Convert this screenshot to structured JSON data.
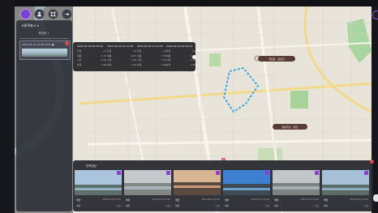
{
  "toolbar": {
    "buttons": [
      {
        "icon": "compass-icon",
        "active": true
      },
      {
        "icon": "person-icon",
        "active": false
      },
      {
        "icon": "grid-icon",
        "active": false
      },
      {
        "icon": "exit-icon",
        "active": false
      }
    ]
  },
  "panel": {
    "select_value": "서울특별시 ▾",
    "subtitle": "행당동 1",
    "item_title": "2024-02-15 14:48 CCTV ●"
  },
  "popup": {
    "columns": [
      {
        "title": "2024-02-16 09:55:43",
        "rows": [
          [
            "유형",
            "(1)"
          ],
          [
            "내용",
            "1.73"
          ],
          [
            "시설",
            "1.56"
          ],
          [
            "상태",
            "1.49"
          ]
        ]
      },
      {
        "title": "2024-02-16 12:11:59",
        "rows": [
          [
            "유형",
            "(1)"
          ],
          [
            "내용",
            "0.47"
          ],
          [
            "시설",
            "1.28"
          ],
          [
            "상태",
            "1.29"
          ]
        ]
      },
      {
        "title": "2024-02-16 17:01:35",
        "rows": [
          [
            "유형",
            "(1)"
          ],
          [
            "내용",
            "1.70"
          ],
          [
            "시설",
            "1.37"
          ],
          [
            "상태",
            "1.26"
          ]
        ]
      },
      {
        "title": "2024-02-16 20:09:10",
        "rows": [
          [
            "유형",
            "(1)"
          ],
          [
            "내용",
            "1.91"
          ],
          [
            "시설",
            "1.73"
          ],
          [
            "상태",
            "1.55"
          ]
        ]
      }
    ]
  },
  "map_labels": [
    {
      "text": "행당동 · 중랑천"
    },
    {
      "text": "왕십리로 · 행당"
    }
  ],
  "gallery": {
    "title": "관측영상",
    "cards": [
      {
        "place": "해당",
        "time": "2024-02-15 14:52",
        "num": "2번",
        "flag": "✓ 확인",
        "img": "sky-river"
      },
      {
        "place": "해당",
        "time": "2024-02-15 14:52",
        "num": "2번",
        "flag": "✓ 확인",
        "img": "gray-river"
      },
      {
        "place": "해당",
        "time": "2024-02-15 14:52",
        "num": "2번",
        "flag": "✓ 확인",
        "img": "sunset"
      },
      {
        "place": "해당",
        "time": "2024-02-15 14:52",
        "num": "2번",
        "flag": "✓ 확인",
        "img": "blue-city"
      },
      {
        "place": "해당",
        "time": "2024-02-15 14:52",
        "num": "2번",
        "flag": "✓ 확인",
        "img": "gray-river"
      },
      {
        "place": "해당",
        "time": "2024-02-15 14:52",
        "num": "2번",
        "flag": "✓ 확인",
        "img": "sky-river"
      }
    ]
  },
  "colors": {
    "accent": "#7b3fd0",
    "badge": "#8a40d8",
    "close": "#e04848",
    "route": "#3fa8e8",
    "label_pill": "#5a3c36"
  }
}
